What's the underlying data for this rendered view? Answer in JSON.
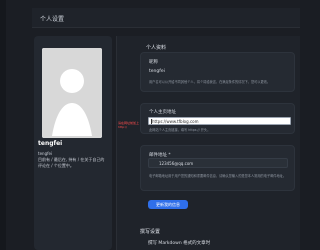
{
  "header": {
    "title": "个人设置"
  },
  "profile": {
    "name": "tengfei",
    "username": "tengfei",
    "bio": "目前有 / 最后在, 持有 / 在关于自己的评论在 / 个位置中。"
  },
  "main": {
    "section_title": "个人资料",
    "fields": {
      "name_label": "昵称",
      "name_value": "tengfei",
      "name_hint": "用户名可以公开给不同其他个人，将个将给我这，在满足条件的情况下，您可以更改。",
      "website_label": "个人主页地址",
      "website_value": "https://www.tfblog.com",
      "website_hint": "此网站个人主页链接，填写 https:// 开头。",
      "email_label": "邮件地址 *",
      "email_value": "123456@qq.com",
      "email_hint": "电子邮箱地址用于用户您的通知和重要邮件信息，请确认您输入的是您本人常用的电子邮件地址。"
    },
    "tooltip": "请在网址前加上http://",
    "update_button": "更新我的信息",
    "bottom_section_title": "撰写设置",
    "bottom_section_subtitle": "撰写 Markdown 格式的文章时"
  }
}
